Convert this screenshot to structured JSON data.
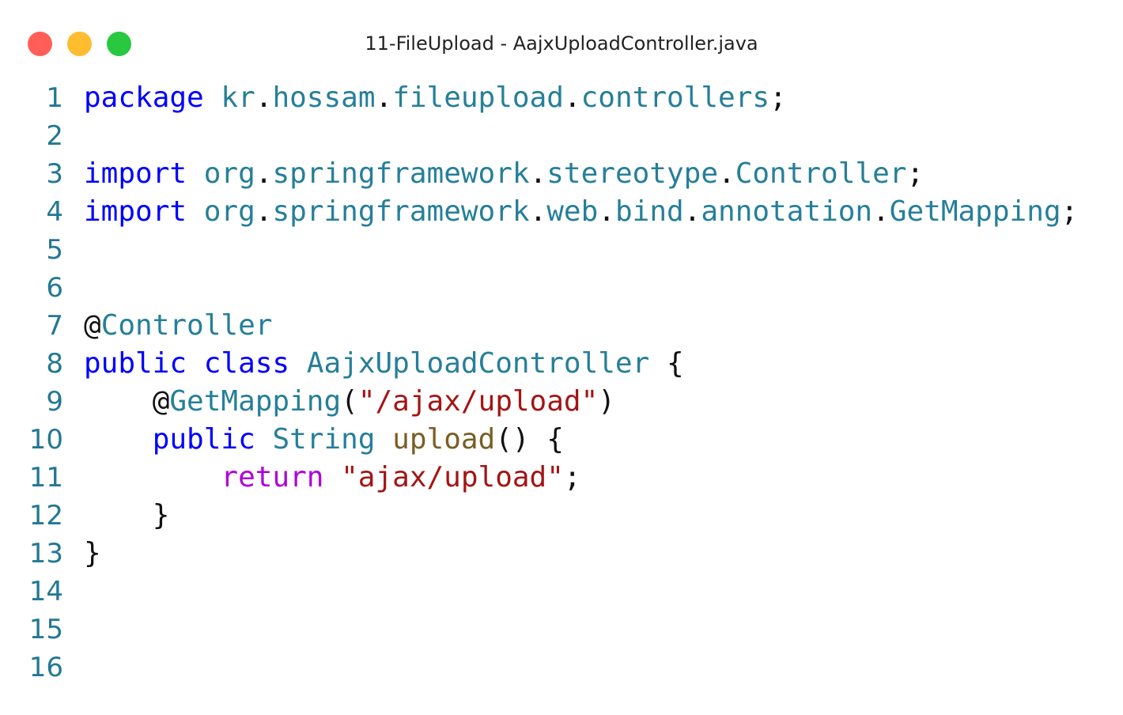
{
  "window": {
    "title": "11-FileUpload - AajxUploadController.java",
    "buttons": {
      "close_color": "#ff5f57",
      "minimize_color": "#febc2e",
      "maximize_color": "#28c840"
    }
  },
  "colors": {
    "line_number": "#237893",
    "keyword": "#0000ff",
    "identifier": "#267f99",
    "plain": "#111111",
    "string": "#a31515",
    "method": "#795e26",
    "control": "#af00db"
  },
  "editor": {
    "lines": [
      {
        "number": "1",
        "tokens": [
          {
            "text": "package",
            "type": "keyword"
          },
          {
            "text": " ",
            "type": "plain"
          },
          {
            "text": "kr",
            "type": "identifier"
          },
          {
            "text": ".",
            "type": "plain"
          },
          {
            "text": "hossam",
            "type": "identifier"
          },
          {
            "text": ".",
            "type": "plain"
          },
          {
            "text": "fileupload",
            "type": "identifier"
          },
          {
            "text": ".",
            "type": "plain"
          },
          {
            "text": "controllers",
            "type": "identifier"
          },
          {
            "text": ";",
            "type": "plain"
          }
        ]
      },
      {
        "number": "2",
        "tokens": []
      },
      {
        "number": "3",
        "tokens": [
          {
            "text": "import",
            "type": "keyword"
          },
          {
            "text": " ",
            "type": "plain"
          },
          {
            "text": "org",
            "type": "identifier"
          },
          {
            "text": ".",
            "type": "plain"
          },
          {
            "text": "springframework",
            "type": "identifier"
          },
          {
            "text": ".",
            "type": "plain"
          },
          {
            "text": "stereotype",
            "type": "identifier"
          },
          {
            "text": ".",
            "type": "plain"
          },
          {
            "text": "Controller",
            "type": "identifier"
          },
          {
            "text": ";",
            "type": "plain"
          }
        ]
      },
      {
        "number": "4",
        "tokens": [
          {
            "text": "import",
            "type": "keyword"
          },
          {
            "text": " ",
            "type": "plain"
          },
          {
            "text": "org",
            "type": "identifier"
          },
          {
            "text": ".",
            "type": "plain"
          },
          {
            "text": "springframework",
            "type": "identifier"
          },
          {
            "text": ".",
            "type": "plain"
          },
          {
            "text": "web",
            "type": "identifier"
          },
          {
            "text": ".",
            "type": "plain"
          },
          {
            "text": "bind",
            "type": "identifier"
          },
          {
            "text": ".",
            "type": "plain"
          },
          {
            "text": "annotation",
            "type": "identifier"
          },
          {
            "text": ".",
            "type": "plain"
          },
          {
            "text": "GetMapping",
            "type": "identifier"
          },
          {
            "text": ";",
            "type": "plain"
          }
        ]
      },
      {
        "number": "5",
        "tokens": []
      },
      {
        "number": "6",
        "tokens": []
      },
      {
        "number": "7",
        "tokens": [
          {
            "text": "@",
            "type": "plain"
          },
          {
            "text": "Controller",
            "type": "identifier"
          }
        ]
      },
      {
        "number": "8",
        "tokens": [
          {
            "text": "public",
            "type": "keyword"
          },
          {
            "text": " ",
            "type": "plain"
          },
          {
            "text": "class",
            "type": "keyword"
          },
          {
            "text": " ",
            "type": "plain"
          },
          {
            "text": "AajxUploadController",
            "type": "identifier"
          },
          {
            "text": " {",
            "type": "plain"
          }
        ]
      },
      {
        "number": "9",
        "tokens": [
          {
            "text": "    @",
            "type": "plain"
          },
          {
            "text": "GetMapping",
            "type": "identifier"
          },
          {
            "text": "(",
            "type": "plain"
          },
          {
            "text": "\"/ajax/upload\"",
            "type": "string"
          },
          {
            "text": ")",
            "type": "plain"
          }
        ]
      },
      {
        "number": "10",
        "tokens": [
          {
            "text": "    ",
            "type": "plain"
          },
          {
            "text": "public",
            "type": "keyword"
          },
          {
            "text": " ",
            "type": "plain"
          },
          {
            "text": "String",
            "type": "identifier"
          },
          {
            "text": " ",
            "type": "plain"
          },
          {
            "text": "upload",
            "type": "method"
          },
          {
            "text": "() {",
            "type": "plain"
          }
        ]
      },
      {
        "number": "11",
        "tokens": [
          {
            "text": "        ",
            "type": "plain"
          },
          {
            "text": "return",
            "type": "control"
          },
          {
            "text": " ",
            "type": "plain"
          },
          {
            "text": "\"ajax/upload\"",
            "type": "string"
          },
          {
            "text": ";",
            "type": "plain"
          }
        ]
      },
      {
        "number": "12",
        "tokens": [
          {
            "text": "    }",
            "type": "plain"
          }
        ]
      },
      {
        "number": "13",
        "tokens": [
          {
            "text": "}",
            "type": "plain"
          }
        ]
      },
      {
        "number": "14",
        "tokens": []
      },
      {
        "number": "15",
        "tokens": []
      },
      {
        "number": "16",
        "tokens": []
      }
    ]
  }
}
